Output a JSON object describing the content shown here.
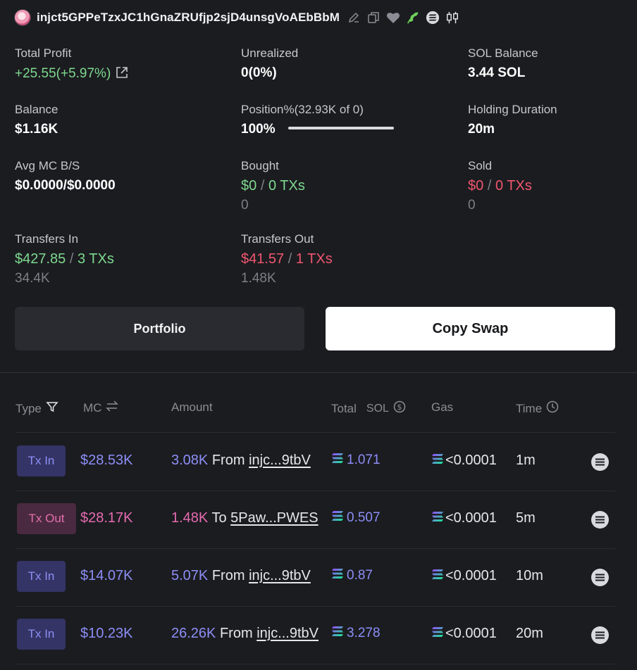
{
  "header": {
    "address": "injct5GPPeTzxJC1hGnaZRUfjp2sjD4unsgVoAEbBbM",
    "icons": [
      "edit-icon",
      "copy-icon",
      "heart-icon",
      "leaf-icon",
      "solana-icon",
      "candlestick-icon"
    ]
  },
  "stats": {
    "total_profit": {
      "label": "Total Profit",
      "value": "+25.55(+5.97%)"
    },
    "unrealized": {
      "label": "Unrealized",
      "value": "0(0%)"
    },
    "sol_balance": {
      "label": "SOL Balance",
      "value": "3.44 SOL"
    },
    "balance": {
      "label": "Balance",
      "value": "$1.16K"
    },
    "position": {
      "label": "Position%(32.93K of 0)",
      "value": "100%",
      "fill": 1.0
    },
    "holding": {
      "label": "Holding Duration",
      "value": "20m"
    },
    "avg_mc": {
      "label": "Avg MC B/S",
      "value": "$0.0000/$0.0000"
    },
    "bought": {
      "label": "Bought",
      "amount": "$0",
      "txs": "0 TXs",
      "sub": "0"
    },
    "sold": {
      "label": "Sold",
      "amount": "$0",
      "txs": "0 TXs",
      "sub": "0"
    },
    "transfers_in": {
      "label": "Transfers In",
      "amount": "$427.85",
      "txs": "3 TXs",
      "sub": "34.4K"
    },
    "transfers_out": {
      "label": "Transfers Out",
      "amount": "$41.57",
      "txs": "1 TXs",
      "sub": "1.48K"
    },
    "slash": "/"
  },
  "buttons": {
    "portfolio": "Portfolio",
    "copy_swap": "Copy Swap"
  },
  "table": {
    "headers": {
      "type": "Type",
      "mc": "MC",
      "amount": "Amount",
      "total": "Total",
      "sol": "SOL",
      "gas": "Gas",
      "time": "Time"
    },
    "rows": [
      {
        "type": "Tx In",
        "mc": "$28.53K",
        "amount": "3.08K",
        "dir": "From",
        "addr": "injc...9tbV",
        "total": "1.071",
        "gas": "<0.0001",
        "time": "1m"
      },
      {
        "type": "Tx Out",
        "mc": "$28.17K",
        "amount": "1.48K",
        "dir": "To",
        "addr": "5Paw...PWES",
        "total": "0.507",
        "gas": "<0.0001",
        "time": "5m"
      },
      {
        "type": "Tx In",
        "mc": "$14.07K",
        "amount": "5.07K",
        "dir": "From",
        "addr": "injc...9tbV",
        "total": "0.87",
        "gas": "<0.0001",
        "time": "10m"
      },
      {
        "type": "Tx In",
        "mc": "$10.23K",
        "amount": "26.26K",
        "dir": "From",
        "addr": "injc...9tbV",
        "total": "3.278",
        "gas": "<0.0001",
        "time": "20m"
      }
    ]
  },
  "colors": {
    "green": "#7ed98f",
    "red": "#f0566e",
    "purple": "#8d8ef6",
    "pink": "#e66bb1"
  }
}
